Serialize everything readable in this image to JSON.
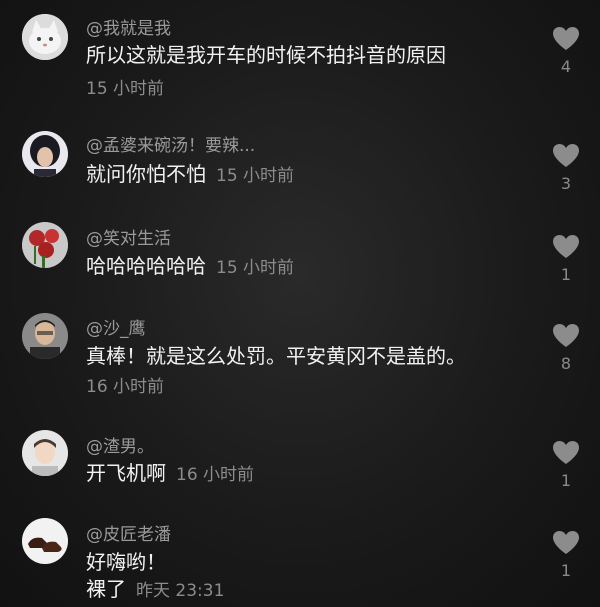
{
  "comments": [
    {
      "username": "@我就是我",
      "text": "所以这就是我开车的时候不拍抖音的原因",
      "time": "15 小时前",
      "likes": "4",
      "avatar_icon": "cat-avatar",
      "avatar_color": "#e9e9e9"
    },
    {
      "username": "@孟婆来碗汤！要辣...",
      "text": "就问你怕不怕",
      "time": "15 小时前",
      "likes": "3",
      "avatar_icon": "person-avatar",
      "avatar_color": "#3a3a44"
    },
    {
      "username": "@笑对生活",
      "text": "哈哈哈哈哈哈",
      "time": "15 小时前",
      "likes": "1",
      "avatar_icon": "roses-avatar",
      "avatar_color": "#b23030"
    },
    {
      "username": "@沙_鹰",
      "text": "真棒！就是这么处罚。平安黄冈不是盖的。",
      "time": "16 小时前",
      "likes": "8",
      "avatar_icon": "man-avatar",
      "avatar_color": "#6a6a6a"
    },
    {
      "username": "@渣男。",
      "text": "开飞机啊",
      "time": "16 小时前",
      "likes": "1",
      "avatar_icon": "boy-avatar",
      "avatar_color": "#d8d8d8"
    },
    {
      "username": "@皮匠老潘",
      "text_line1": "好嗨哟！",
      "text_line2": "裸了",
      "time": "昨天 23:31",
      "likes": "1",
      "avatar_icon": "shoes-avatar",
      "avatar_color": "#f0f0f0"
    }
  ]
}
